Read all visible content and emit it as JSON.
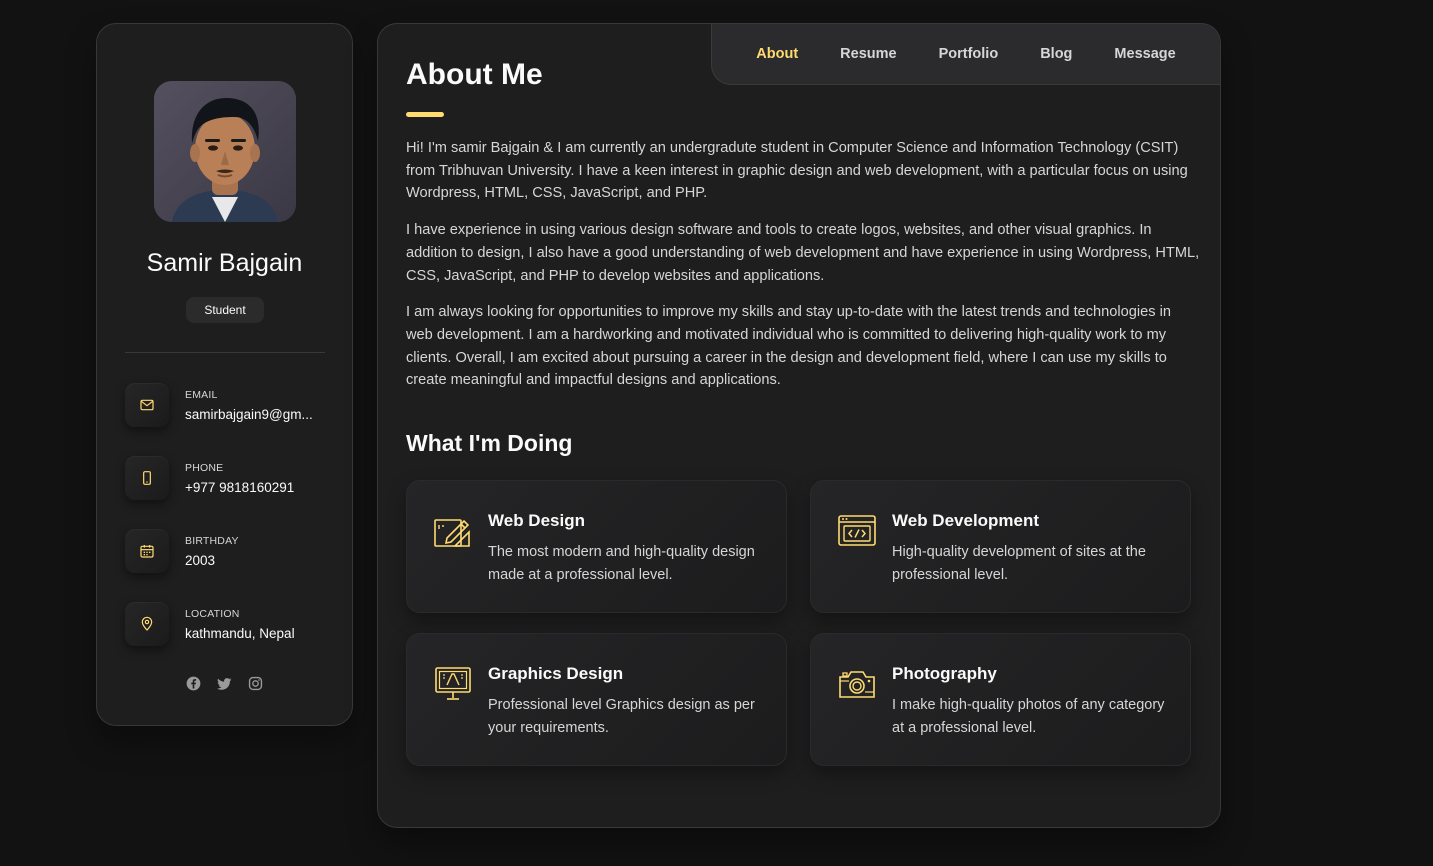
{
  "sidebar": {
    "name": "Samir Bajgain",
    "title": "Student",
    "contacts": [
      {
        "label": "Email",
        "value": "samirbajgain9@gm...",
        "icon": "mail-icon"
      },
      {
        "label": "Phone",
        "value": "+977 9818160291",
        "icon": "phone-icon"
      },
      {
        "label": "Birthday",
        "value": "2003",
        "icon": "calendar-icon"
      },
      {
        "label": "Location",
        "value": "kathmandu, Nepal",
        "icon": "location-pin-icon"
      }
    ],
    "socials": [
      "facebook-icon",
      "twitter-icon",
      "instagram-icon"
    ]
  },
  "navbar": {
    "items": [
      "About",
      "Resume",
      "Portfolio",
      "Blog",
      "Message"
    ],
    "active": "About"
  },
  "about": {
    "title": "About Me",
    "paragraphs": [
      "Hi! I'm samir Bajgain & I am currently an undergradute student in Computer Science and Information Technology (CSIT) from Tribhuvan University. I have a keen interest in graphic design and web development, with a particular focus on using Wordpress, HTML, CSS, JavaScript, and PHP.",
      "I have experience in using various design software and tools to create logos, websites, and other visual graphics. In addition to design, I also have a good understanding of web development and have experience in using Wordpress, HTML, CSS, JavaScript, and PHP to develop websites and applications.",
      "I am always looking for opportunities to improve my skills and stay up-to-date with the latest trends and technologies in web development. I am a hardworking and motivated individual who is committed to delivering high-quality work to my clients. Overall, I am excited about pursuing a career in the design and development field, where I can use my skills to create meaningful and impactful designs and applications."
    ]
  },
  "services": {
    "title": "What I'm Doing",
    "items": [
      {
        "title": "Web Design",
        "text": "The most modern and high-quality design made at a professional level.",
        "icon": "design-pen-icon"
      },
      {
        "title": "Web Development",
        "text": "High-quality development of sites at the professional level.",
        "icon": "code-window-icon"
      },
      {
        "title": "Graphics Design",
        "text": "Professional level Graphics design as per your requirements.",
        "icon": "monitor-design-icon"
      },
      {
        "title": "Photography",
        "text": "I make high-quality photos of any category at a professional level.",
        "icon": "camera-icon"
      }
    ]
  },
  "colors": {
    "accent": "#ffdb70",
    "background": "#121212",
    "card": "#1e1e1f"
  }
}
